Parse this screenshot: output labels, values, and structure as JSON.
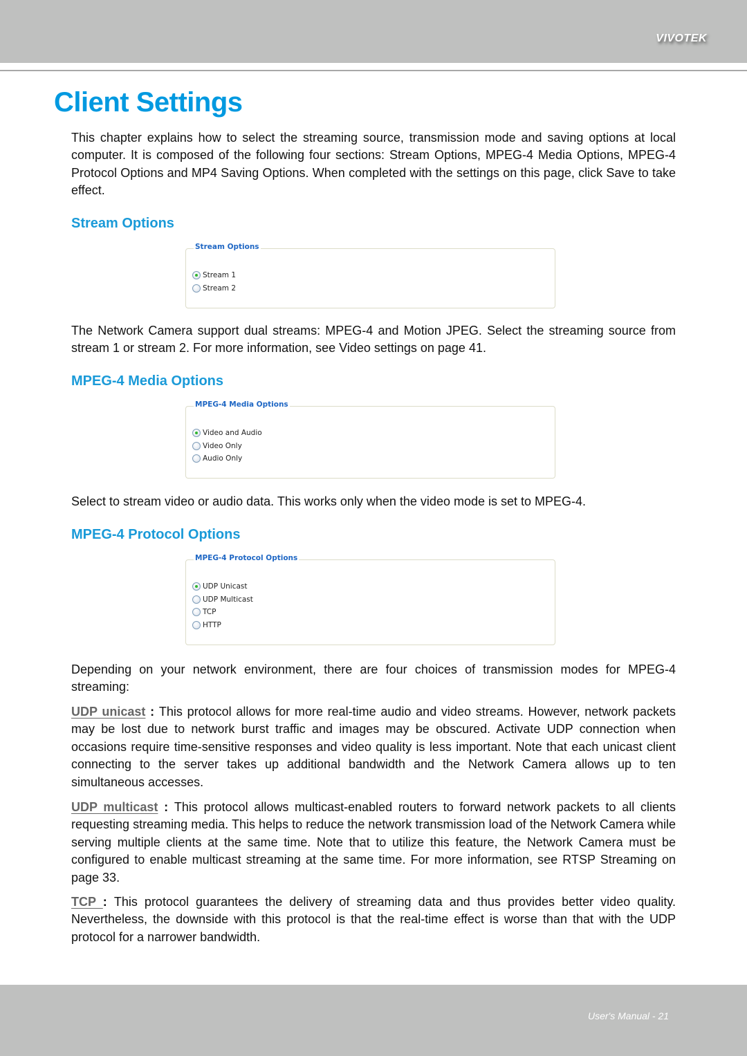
{
  "header": {
    "brand": "VIVOTEK"
  },
  "page": {
    "title": "Client Settings",
    "intro": "This chapter explains how to select the streaming source, transmission mode and saving options at local computer. It is composed of the following four sections: Stream Options, MPEG-4 Media Options, MPEG-4 Protocol Options and MP4 Saving Options. When completed with the settings on this page, click Save to take effect."
  },
  "sections": {
    "stream": {
      "heading": "Stream Options",
      "panel": {
        "legend": "Stream Options",
        "options": [
          {
            "label": "Stream 1",
            "checked": true
          },
          {
            "label": "Stream 2",
            "checked": false
          }
        ]
      },
      "description": "The Network Camera support dual streams: MPEG-4 and Motion JPEG. Select the streaming source from stream 1 or stream 2. For more information, see Video settings on page 41."
    },
    "media": {
      "heading": "MPEG-4 Media Options",
      "panel": {
        "legend": "MPEG-4 Media Options",
        "options": [
          {
            "label": "Video and Audio",
            "checked": true
          },
          {
            "label": "Video Only",
            "checked": false
          },
          {
            "label": "Audio Only",
            "checked": false
          }
        ]
      },
      "description": "Select to stream video or audio data. This works only when the video mode is set to MPEG-4."
    },
    "protocol": {
      "heading": "MPEG-4 Protocol Options",
      "panel": {
        "legend": "MPEG-4 Protocol Options",
        "options": [
          {
            "label": "UDP Unicast",
            "checked": true
          },
          {
            "label": "UDP Multicast",
            "checked": false
          },
          {
            "label": "TCP",
            "checked": false
          },
          {
            "label": "HTTP",
            "checked": false
          }
        ]
      },
      "description": "Depending on your network environment, there are four choices of transmission modes for MPEG-4 streaming:",
      "terms": [
        {
          "term": "UDP unicast",
          "separator": " : ",
          "text": "This protocol allows for more real-time audio and video streams. However, network packets may be lost due to network burst traffic and images may be obscured. Activate UDP connection when occasions require time-sensitive responses and video quality is less important. Note that each unicast client connecting to the server takes up additional bandwidth and the Network Camera allows up to ten simultaneous accesses."
        },
        {
          "term": "UDP multicast",
          "separator": " : ",
          "text": "This protocol allows multicast-enabled routers to forward network packets to all clients requesting streaming media. This helps to reduce the network transmission load of the Network Camera while serving multiple clients at the same time. Note that to utilize this feature, the Network Camera must be configured to enable multicast streaming at the same time. For more information, see RTSP Streaming on page 33."
        },
        {
          "term": "TCP ",
          "separator": " : ",
          "text": "This protocol guarantees the delivery of streaming data and thus provides better video quality. Nevertheless, the downside with this protocol is that the real-time effect is worse than that with the UDP protocol for a narrower bandwidth."
        }
      ]
    }
  },
  "footer": {
    "text": "User's Manual - 21"
  },
  "colors": {
    "title": "#0099e0",
    "section_heading": "#1a9ad8",
    "panel_legend": "#1f67c4",
    "band": "#bfc0bf",
    "term": "#666666"
  }
}
